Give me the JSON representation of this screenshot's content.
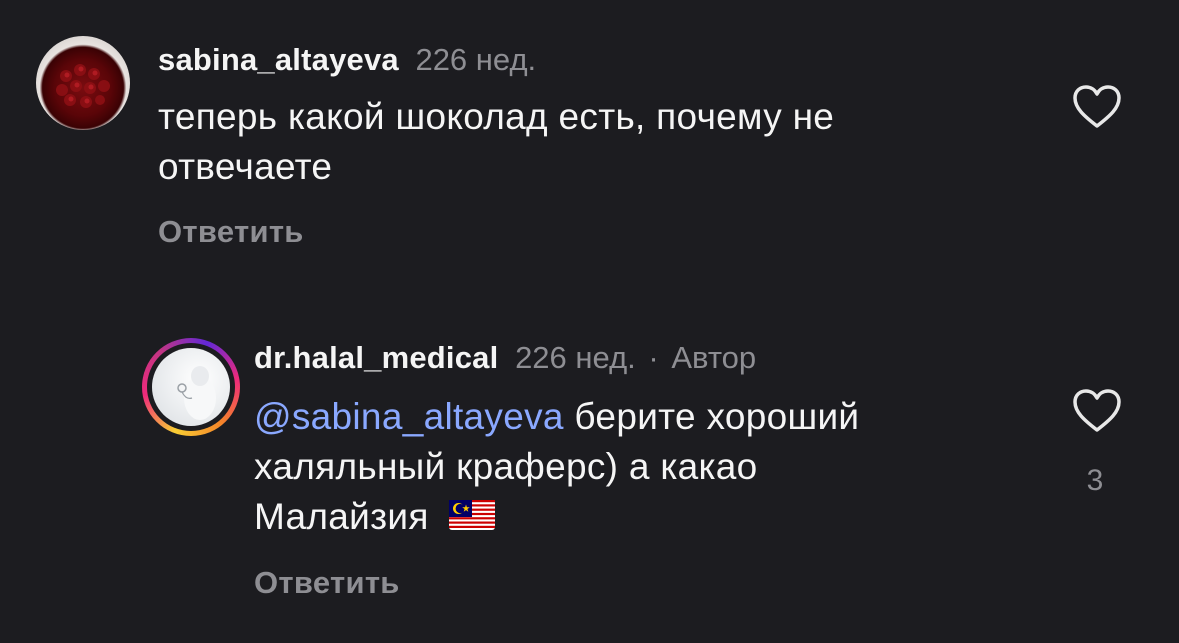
{
  "comments": [
    {
      "username": "sabina_altayeva",
      "time": "226 нед.",
      "text": "теперь какой шоколад есть, почему не отвечаете",
      "text_line1": "теперь какой шоколад есть, почему не",
      "text_line2": "отвечаете",
      "reply_label": "Ответить",
      "avatar_icon": "rose-bouquet-avatar"
    },
    {
      "username": "dr.halal_medical",
      "time": "226 нед.",
      "separator": "·",
      "author_badge": "Автор",
      "mention": "@sabina_altayeva",
      "text_line1_rest": " берите хороший",
      "text_line2": "халяльный краферс) а какао",
      "text_line3": "Малайзия",
      "flag_icon": "malaysia-flag-emoji",
      "reply_label": "Ответить",
      "like_count": "3",
      "avatar_icon": "doctor-avatar-story-ring"
    }
  ],
  "colors": {
    "background": "#1c1c20",
    "text": "#f5f5f5",
    "muted": "#8e8e93",
    "mention": "#8aa8ff"
  }
}
